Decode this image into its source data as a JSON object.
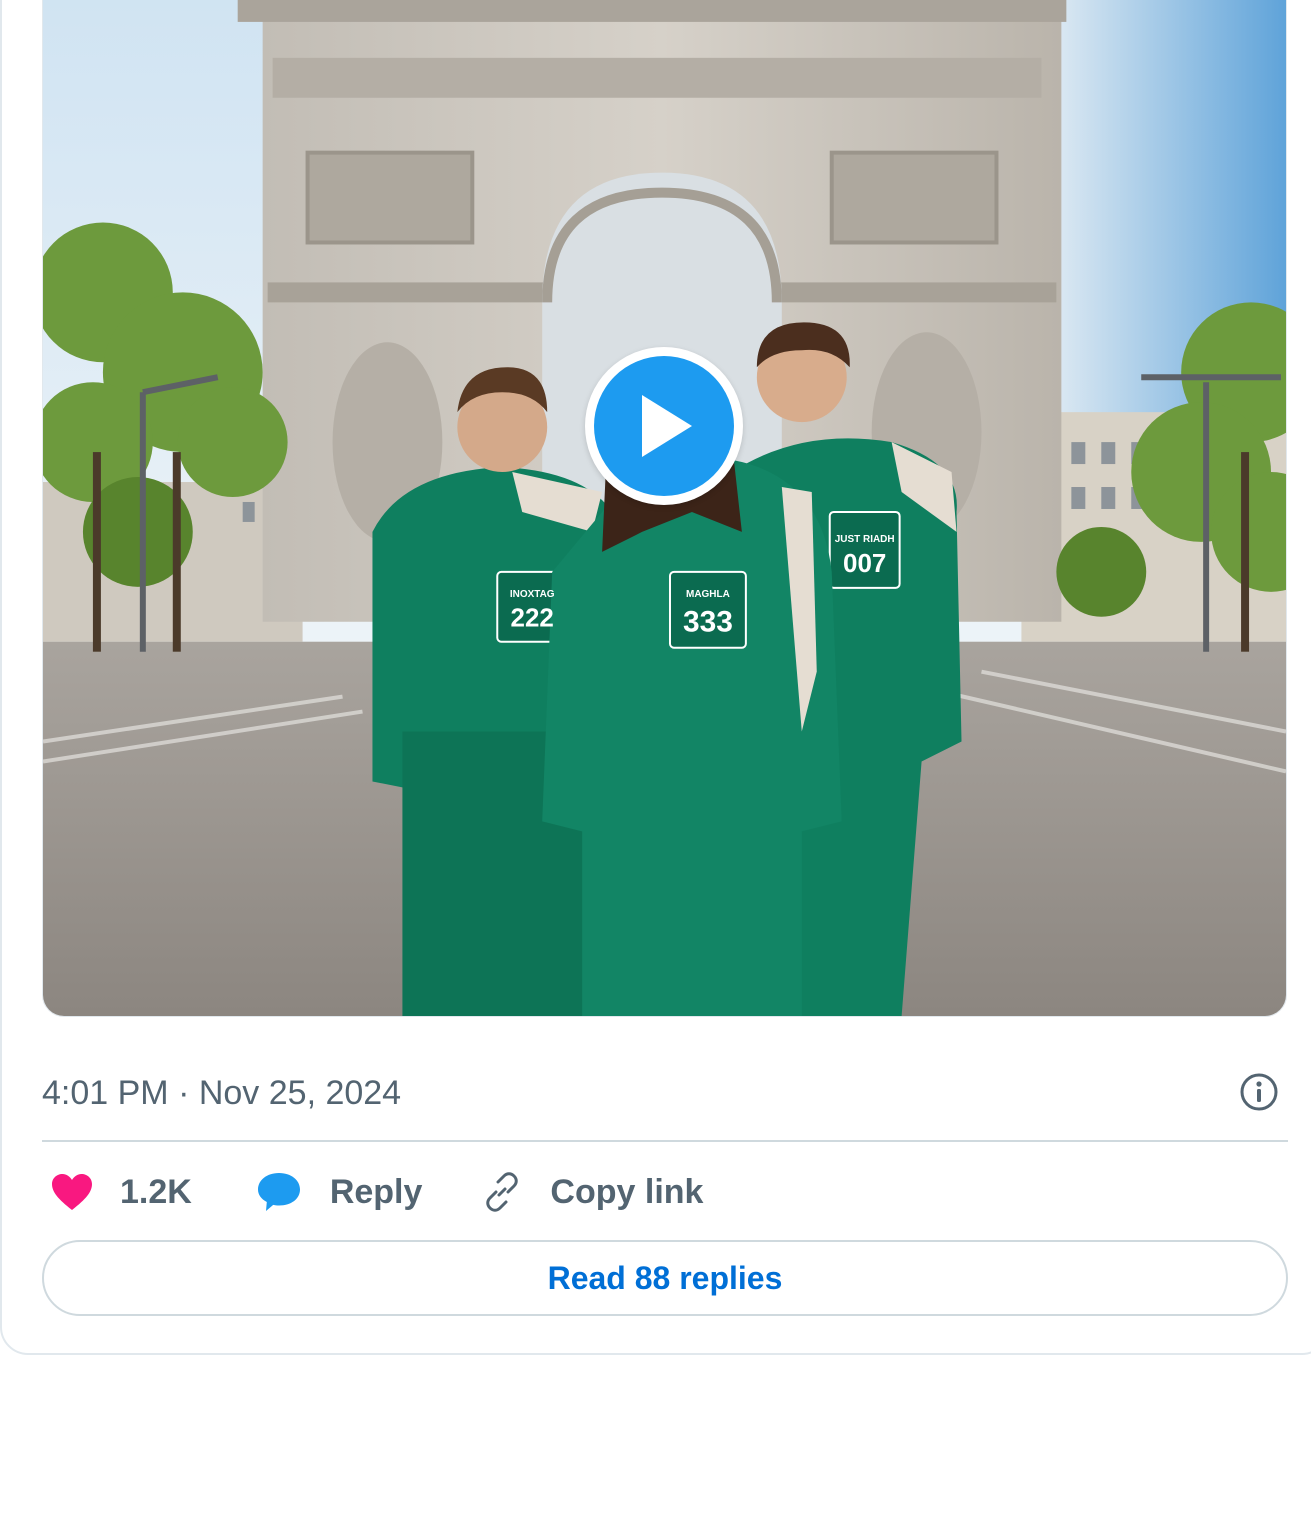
{
  "tweet": {
    "media": {
      "bibs": [
        {
          "name": "INOXTAG",
          "number": "222"
        },
        {
          "name": "MAGHLA",
          "number": "333"
        },
        {
          "name": "JUST RIADH",
          "number": "007"
        }
      ]
    },
    "timestamp": "4:01 PM · Nov 25, 2024",
    "actions": {
      "like_count": "1.2K",
      "reply_label": "Reply",
      "copy_link_label": "Copy link"
    },
    "read_replies_label": "Read 88 replies"
  },
  "colors": {
    "like": "#f91880",
    "reply": "#1d9bf0",
    "link_text": "#006fd6",
    "secondary_text": "#536471",
    "jacket": "#0f7f5f"
  },
  "icons": [
    "play-icon",
    "info-icon",
    "heart-icon",
    "comment-bubble-icon",
    "link-icon"
  ]
}
